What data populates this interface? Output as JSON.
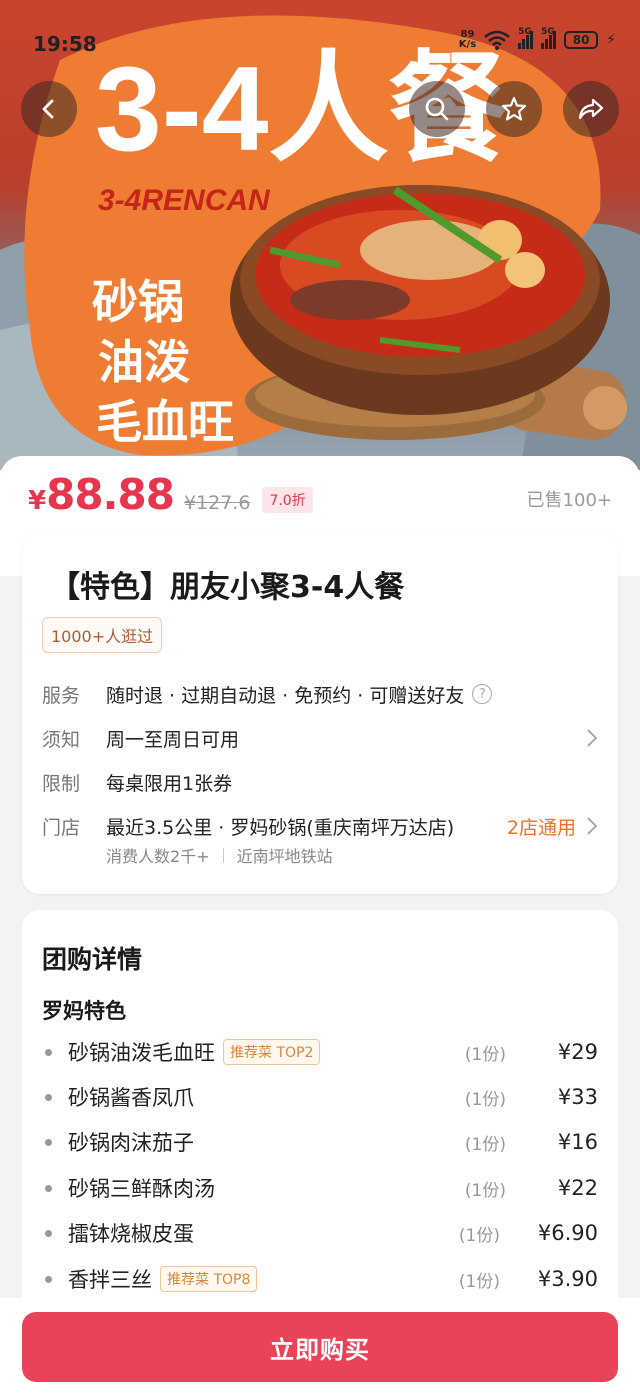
{
  "status_bar": {
    "time": "19:58",
    "net_speed_value": "89",
    "net_speed_unit": "K/s",
    "signal_1": "5G",
    "signal_2": "5G",
    "battery": "80"
  },
  "hero": {
    "banner_title": "3-4人餐",
    "banner_subtitle": "3-4RENCAN",
    "dish_line_1": "砂锅",
    "dish_line_2": "油泼",
    "dish_line_3": "毛血旺",
    "nav_icons": [
      "back-icon",
      "search-icon",
      "star-icon",
      "share-icon"
    ]
  },
  "price": {
    "currency": "¥",
    "current": "88.88",
    "original": "¥127.6",
    "discount": "7.0折",
    "sold": "已售100+"
  },
  "deal": {
    "title": "【特色】朋友小聚3-4人餐",
    "visit_tag": "1000+人逛过",
    "rows": [
      {
        "label": "服务",
        "value": "随时退 · 过期自动退 · 免预约 · 可赠送好友"
      },
      {
        "label": "须知",
        "value": "周一至周日可用"
      },
      {
        "label": "限制",
        "value": "每桌限用1张券"
      },
      {
        "label": "门店",
        "value": "最近3.5公里 · 罗妈砂锅(重庆南坪万达店)"
      }
    ],
    "help_glyph": "?",
    "store_count": "2店通用",
    "store_sub_1": "消费人数2千+",
    "store_sub_2": "近南坪地铁站"
  },
  "details": {
    "title": "团购详情",
    "section": "罗妈特色",
    "items": [
      {
        "name": "砂锅油泼毛血旺",
        "tag": "推荐菜 TOP2",
        "qty": "(1份)",
        "price": "¥29"
      },
      {
        "name": "砂锅酱香凤爪",
        "tag": "",
        "qty": "(1份)",
        "price": "¥33"
      },
      {
        "name": "砂锅肉沫茄子",
        "tag": "",
        "qty": "(1份)",
        "price": "¥16"
      },
      {
        "name": "砂锅三鲜酥肉汤",
        "tag": "",
        "qty": "(1份)",
        "price": "¥22"
      },
      {
        "name": "擂钵烧椒皮蛋",
        "tag": "",
        "qty": "(1份)",
        "price": "¥6.90"
      },
      {
        "name": "香拌三丝",
        "tag": "推荐菜 TOP8",
        "qty": "(1份)",
        "price": "¥3.90"
      }
    ]
  },
  "buy_button": "立即购买",
  "colors": {
    "accent": "#e8344d",
    "button": "#e9435a",
    "orange": "#f07226",
    "banner_orange": "#ef7c33"
  }
}
